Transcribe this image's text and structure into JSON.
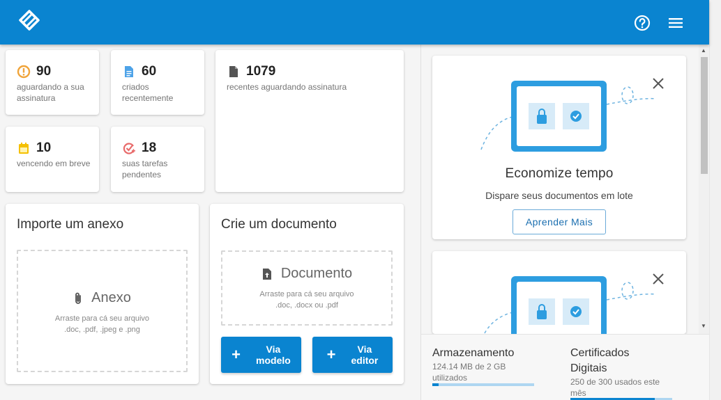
{
  "header": {
    "logo_icon": "handshake-logo-icon",
    "help_icon": "help-circle-icon",
    "menu_icon": "hamburger-menu-icon",
    "background": "#0a84d0"
  },
  "stats": [
    {
      "value": "90",
      "label": "aguardando a sua assinatura",
      "icon": "alert-circle-icon",
      "color": "#f0a43a"
    },
    {
      "value": "60",
      "label": "criados recentemente",
      "icon": "document-icon",
      "color": "#4ea3e8"
    },
    {
      "value": "1079",
      "label": "recentes aguardando assinatura",
      "icon": "file-icon",
      "color": "#555555"
    },
    {
      "value": "10",
      "label": "vencendo em breve",
      "icon": "calendar-icon",
      "color": "#f5c000"
    },
    {
      "value": "18",
      "label": "suas tarefas pendentes",
      "icon": "task-check-icon",
      "color": "#e86a6a"
    }
  ],
  "import_panel": {
    "title": "Importe um anexo",
    "drop_title": "Anexo",
    "drop_hint_line1": "Arraste para cá seu arquivo",
    "drop_hint_line2": ".doc, .pdf, .jpeg e .png"
  },
  "create_panel": {
    "title": "Crie um documento",
    "drop_title": "Documento",
    "drop_hint_line1": "Arraste para cá seu arquivo",
    "drop_hint_line2": ".doc, .docx ou .pdf",
    "btn_model_line1": "Via",
    "btn_model_line2": "modelo",
    "btn_editor_line1": "Via",
    "btn_editor_line2": "editor"
  },
  "promos": [
    {
      "title": "Economize tempo",
      "subtitle": "Dispare seus documentos em lote",
      "button": "Aprender Mais"
    },
    {
      "title": "",
      "subtitle": "",
      "button": ""
    }
  ],
  "storage": {
    "title": "Armazenamento",
    "detail_line1": "124.14 MB de 2 GB",
    "detail_line2": "utilizados",
    "usage_fraction": 0.06
  },
  "certificates": {
    "title_line1": "Certificados",
    "title_line2": "Digitais",
    "detail_line1": "250 de 300 usados este",
    "detail_line2": "mês",
    "usage_fraction": 0.83
  }
}
